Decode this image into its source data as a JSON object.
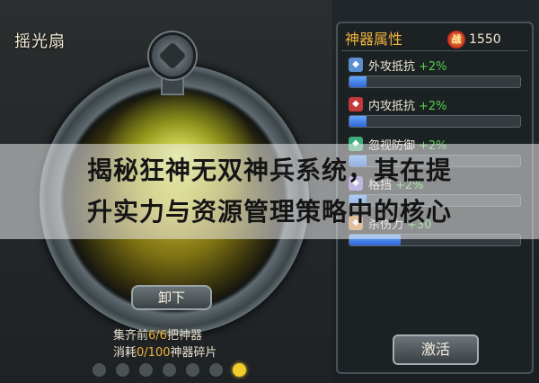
{
  "weapon": {
    "name": "摇光扇"
  },
  "buttons": {
    "unequip": "卸下",
    "activate": "激活"
  },
  "requirements": {
    "line1_prefix": "集齐前",
    "line1_count": "6/6",
    "line1_suffix": "把神器",
    "line2_prefix": "消耗",
    "line2_count": "0/100",
    "line2_suffix": "神器碎片"
  },
  "panel": {
    "title": "神器属性",
    "power_icon_text": "战",
    "power_value": "1550",
    "stats": [
      {
        "label": "外攻抵抗",
        "bonus": "+2%",
        "icon": "shield-icon",
        "icon_color": "#5b8fd0",
        "fill": 0.1
      },
      {
        "label": "内攻抵抗",
        "bonus": "+2%",
        "icon": "cross-icon",
        "icon_color": "#c23a3a",
        "fill": 0.1
      },
      {
        "label": "忽视防御",
        "bonus": "+2%",
        "icon": "sword-icon",
        "icon_color": "#3fae7a",
        "fill": 0.1
      },
      {
        "label": "格挡",
        "bonus": "+2%",
        "icon": "guard-icon",
        "icon_color": "#8a6fd0",
        "fill": 0.1
      },
      {
        "label": "杀伤力",
        "bonus": "+30",
        "icon": "blade-icon",
        "icon_color": "#d08a3a",
        "fill": 0.3
      }
    ]
  },
  "pagination": {
    "count": 7,
    "active_index": 6
  },
  "banner": {
    "line1": "揭秘狂神无双神兵系统，其在提",
    "line2": "升实力与资源管理策略中的核心"
  }
}
